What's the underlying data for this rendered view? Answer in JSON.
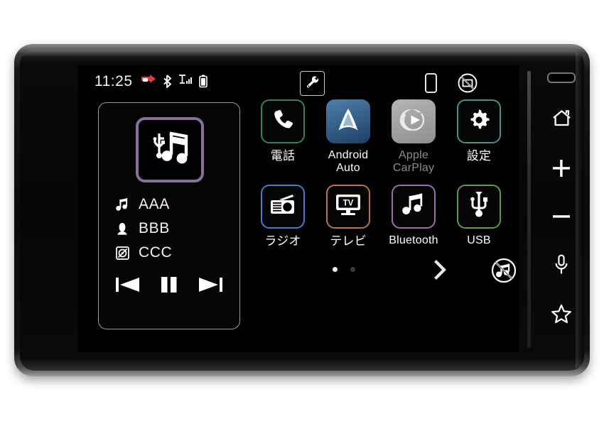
{
  "device": {
    "name": "car-head-unit",
    "screen_label": "home-screen"
  },
  "status_bar": {
    "clock": "11:25",
    "icons": [
      {
        "name": "etc-card-icon",
        "color": "#e03a4a"
      },
      {
        "name": "bluetooth-icon",
        "color": "#ffffff"
      },
      {
        "name": "signal-strength-icon",
        "color": "#ffffff"
      },
      {
        "name": "battery-icon",
        "color": "#ffffff"
      }
    ],
    "tool_button": {
      "name": "wrench-icon"
    },
    "right_icons": [
      {
        "name": "smartphone-icon"
      },
      {
        "name": "display-off-icon"
      }
    ]
  },
  "media_player": {
    "source": "USB",
    "album_art_icon": "usb-music-icon",
    "album_art_border": "#8b6f9b",
    "rows": [
      {
        "icon": "music-note-icon",
        "text": "AAA"
      },
      {
        "icon": "artist-icon",
        "text": "BBB"
      },
      {
        "icon": "album-icon",
        "text": "CCC"
      }
    ],
    "controls": [
      {
        "name": "previous-track-button",
        "icon": "skip-previous-icon"
      },
      {
        "name": "pause-button",
        "icon": "pause-icon"
      },
      {
        "name": "next-track-button",
        "icon": "skip-next-icon"
      }
    ]
  },
  "app_grid": {
    "rows": [
      [
        {
          "id": "phone",
          "label": "電話",
          "icon": "phone-icon",
          "style": "bordered",
          "border": "#2f7f73",
          "dim": false,
          "multiline": false
        },
        {
          "id": "android-auto",
          "label": "Android\nAuto",
          "icon": "android-auto-icon",
          "style": "filled",
          "border": "#2c5f90",
          "dim": false,
          "multiline": true
        },
        {
          "id": "apple-carplay",
          "label": "Apple\nCarPlay",
          "icon": "carplay-icon",
          "style": "filled",
          "border": "#9a9a9a",
          "dim": true,
          "multiline": true
        },
        {
          "id": "settings",
          "label": "設定",
          "icon": "gear-icon",
          "style": "bordered",
          "border": "#4c8f8c",
          "dim": false,
          "multiline": false
        }
      ],
      [
        {
          "id": "radio",
          "label": "ラジオ",
          "icon": "radio-icon",
          "style": "bordered",
          "border": "#3f7fd0",
          "dim": false,
          "multiline": false
        },
        {
          "id": "tv",
          "label": "テレビ",
          "icon": "tv-icon",
          "style": "bordered",
          "border": "#b5793c",
          "dim": false,
          "multiline": false
        },
        {
          "id": "bluetooth",
          "label": "Bluetooth",
          "icon": "music-note-icon",
          "style": "bordered",
          "border": "#9b6fae",
          "dim": false,
          "multiline": false
        },
        {
          "id": "usb",
          "label": "USB",
          "icon": "usb-icon",
          "style": "bordered",
          "border": "#5f9a4e",
          "dim": false,
          "multiline": false
        }
      ]
    ]
  },
  "footer": {
    "page_dots": {
      "count": 2,
      "active_index": 0
    },
    "next_page": {
      "name": "next-page-button",
      "glyph": "›"
    },
    "mute": {
      "name": "mute-button",
      "icon": "mute-music-icon"
    }
  },
  "hardware_buttons": [
    {
      "id": "home",
      "icon": "home-icon"
    },
    {
      "id": "volume-up",
      "icon": "plus-icon"
    },
    {
      "id": "volume-down",
      "icon": "minus-icon"
    },
    {
      "id": "voice",
      "icon": "microphone-icon"
    },
    {
      "id": "favorite",
      "icon": "star-icon"
    }
  ]
}
